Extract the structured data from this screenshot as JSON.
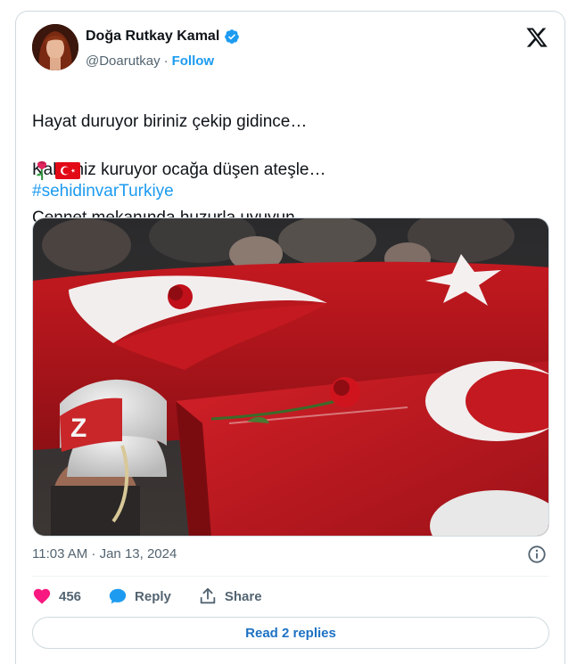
{
  "author": {
    "name": "Doğa Rutkay Kamal",
    "handle": "@Doarutkay",
    "separator": "·",
    "follow_label": "Follow"
  },
  "tweet": {
    "lines": [
      "Hayat duruyor biriniz çekip gidince…",
      "Kalbimiz kuruyor ocağa düşen ateşle…",
      "Cennet mekanında huzurla uyuyun."
    ],
    "emojis": [
      "rose-icon",
      "turkey-flag-icon"
    ],
    "hashtag": "#sehidinvarTurkiye",
    "timestamp": "11:03 AM · Jan 13, 2024"
  },
  "media": {
    "icons": [
      "photo-coffins-flag"
    ],
    "visible_text": [
      "Z"
    ]
  },
  "actions": {
    "likes": "456",
    "reply_label": "Reply",
    "share_label": "Share"
  },
  "read_replies_label": "Read 2 replies",
  "colors": {
    "accent": "#1d9bf0",
    "like": "#f91880",
    "text": "#0f1419",
    "muted": "#536471",
    "border": "#cfd9de"
  }
}
